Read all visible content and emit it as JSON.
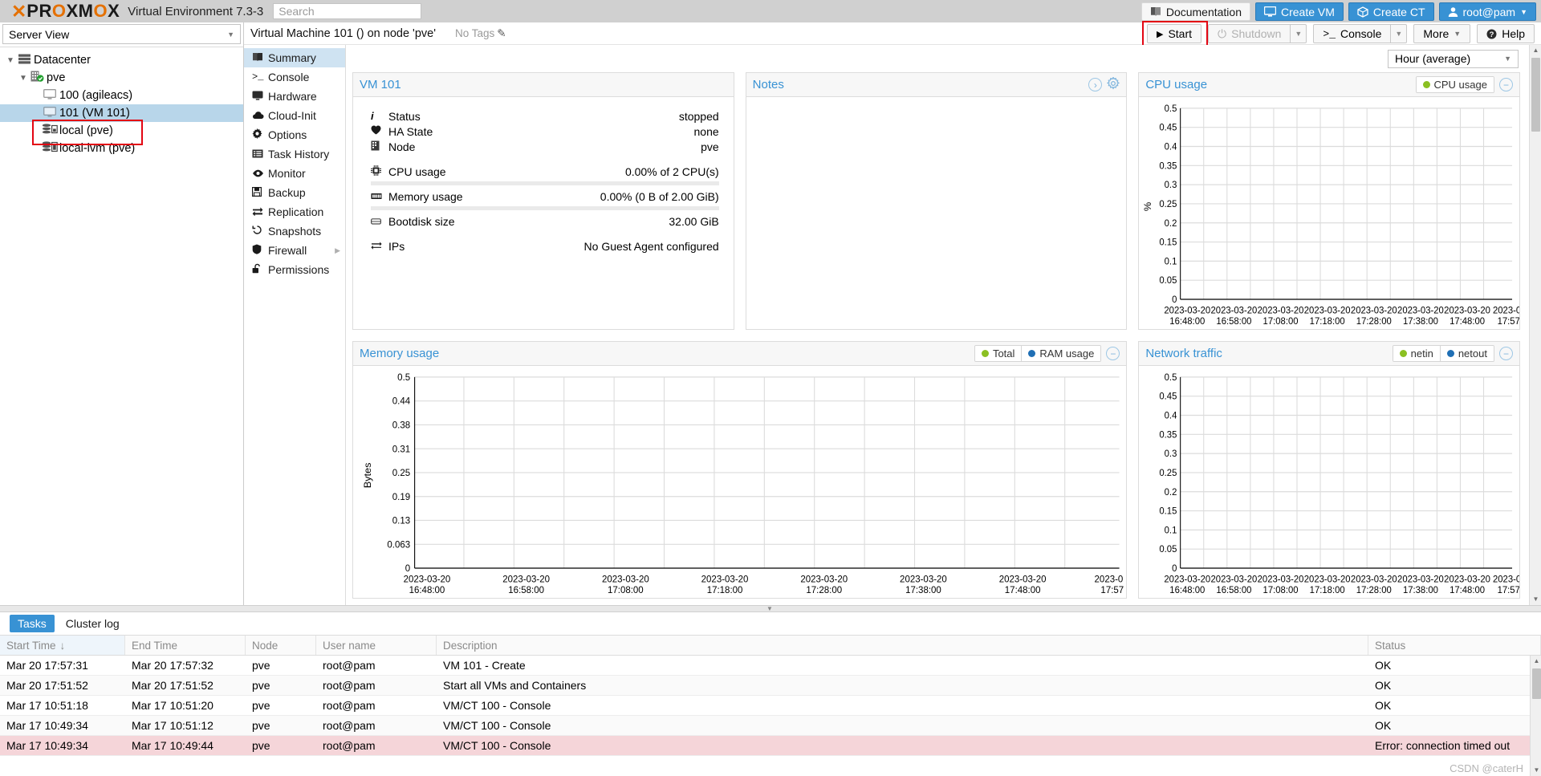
{
  "topbar": {
    "logo_text": "PROXMOX",
    "product": "Virtual Environment 7.3-3",
    "search_placeholder": "Search",
    "search_value": "",
    "documentation": "Documentation",
    "create_vm": "Create VM",
    "create_ct": "Create CT",
    "user": "root@pam"
  },
  "tree": {
    "view_label": "Server View",
    "nodes": [
      {
        "label": "Datacenter",
        "icon": "datacenter-icon",
        "depth": 0,
        "selected": false,
        "expanded": true
      },
      {
        "label": "pve",
        "icon": "node-icon",
        "depth": 1,
        "selected": false,
        "expanded": true
      },
      {
        "label": "100 (agileacs)",
        "icon": "vm-icon",
        "depth": 2,
        "selected": false,
        "expanded": false
      },
      {
        "label": "101 (VM 101)",
        "icon": "vm-icon",
        "depth": 2,
        "selected": true,
        "expanded": false
      },
      {
        "label": "local (pve)",
        "icon": "storage-icon",
        "depth": 2,
        "selected": false,
        "expanded": false
      },
      {
        "label": "local-lvm (pve)",
        "icon": "storage-icon",
        "depth": 2,
        "selected": false,
        "expanded": false
      }
    ]
  },
  "header": {
    "title": "Virtual Machine 101 () on node 'pve'",
    "tags_label": "No Tags",
    "actions": {
      "start": "Start",
      "shutdown": "Shutdown",
      "console": "Console",
      "more": "More",
      "help": "Help"
    }
  },
  "submenu": {
    "items": [
      {
        "label": "Summary",
        "icon": "summary-icon",
        "active": true,
        "arrow": false
      },
      {
        "label": "Console",
        "icon": "console-icon",
        "active": false,
        "arrow": false
      },
      {
        "label": "Hardware",
        "icon": "hardware-icon",
        "active": false,
        "arrow": false
      },
      {
        "label": "Cloud-Init",
        "icon": "cloud-icon",
        "active": false,
        "arrow": false
      },
      {
        "label": "Options",
        "icon": "gear-icon",
        "active": false,
        "arrow": false
      },
      {
        "label": "Task History",
        "icon": "task-history-icon",
        "active": false,
        "arrow": false
      },
      {
        "label": "Monitor",
        "icon": "eye-icon",
        "active": false,
        "arrow": false
      },
      {
        "label": "Backup",
        "icon": "save-icon",
        "active": false,
        "arrow": false
      },
      {
        "label": "Replication",
        "icon": "replication-icon",
        "active": false,
        "arrow": false
      },
      {
        "label": "Snapshots",
        "icon": "snapshot-icon",
        "active": false,
        "arrow": false
      },
      {
        "label": "Firewall",
        "icon": "shield-icon",
        "active": false,
        "arrow": true
      },
      {
        "label": "Permissions",
        "icon": "lock-open-icon",
        "active": false,
        "arrow": false
      }
    ]
  },
  "dashboard": {
    "range_value": "Hour (average)",
    "vm_panel": {
      "title": "VM 101",
      "rows": [
        {
          "icon": "info-icon",
          "key": "Status",
          "value": "stopped",
          "bar": false
        },
        {
          "icon": "heart-icon",
          "key": "HA State",
          "value": "none",
          "bar": false
        },
        {
          "icon": "node-icon",
          "key": "Node",
          "value": "pve",
          "bar": false
        },
        {
          "icon": "cpu-icon",
          "key": "CPU usage",
          "value": "0.00% of 2 CPU(s)",
          "bar": true
        },
        {
          "icon": "memory-icon",
          "key": "Memory usage",
          "value": "0.00% (0 B of 2.00 GiB)",
          "bar": true
        },
        {
          "icon": "disk-icon",
          "key": "Bootdisk size",
          "value": "32.00 GiB",
          "bar": false
        },
        {
          "icon": "network-icon",
          "key": "IPs",
          "value": "No Guest Agent configured",
          "bar": false
        }
      ]
    },
    "notes_panel": {
      "title": "Notes"
    }
  },
  "chart_data": [
    {
      "type": "line",
      "title": "CPU usage",
      "xlabel": "",
      "ylabel": "%",
      "ylim": [
        0,
        0.5
      ],
      "yticks": [
        "0",
        "0.05",
        "0.1",
        "0.15",
        "0.2",
        "0.25",
        "0.3",
        "0.35",
        "0.4",
        "0.45",
        "0.5"
      ],
      "xticks": [
        "2023-03-20\n16:48:00",
        "2023-03-20\n16:58:00",
        "2023-03-20\n17:08:00",
        "2023-03-20\n17:18:00",
        "2023-03-20\n17:28:00",
        "2023-03-20\n17:38:00",
        "2023-03-20\n17:48:00",
        "2023-0\n17:57"
      ],
      "grid": true,
      "legend": [
        {
          "name": "CPU usage",
          "color": "#8bc022"
        }
      ],
      "series": [
        {
          "name": "CPU usage",
          "values": []
        }
      ]
    },
    {
      "type": "line",
      "title": "Memory usage",
      "xlabel": "",
      "ylabel": "Bytes",
      "ylim": [
        0,
        0.5
      ],
      "yticks": [
        "0",
        "0.063",
        "0.13",
        "0.19",
        "0.25",
        "0.31",
        "0.38",
        "0.44",
        "0.5"
      ],
      "xticks": [
        "2023-03-20\n16:48:00",
        "2023-03-20\n16:58:00",
        "2023-03-20\n17:08:00",
        "2023-03-20\n17:18:00",
        "2023-03-20\n17:28:00",
        "2023-03-20\n17:38:00",
        "2023-03-20\n17:48:00",
        "2023-0\n17:57"
      ],
      "grid": true,
      "legend": [
        {
          "name": "Total",
          "color": "#8bc022"
        },
        {
          "name": "RAM usage",
          "color": "#1f6fb5"
        }
      ],
      "series": [
        {
          "name": "Total",
          "values": []
        },
        {
          "name": "RAM usage",
          "values": []
        }
      ]
    },
    {
      "type": "line",
      "title": "Network traffic",
      "xlabel": "",
      "ylabel": "",
      "ylim": [
        0,
        0.5
      ],
      "yticks": [
        "0",
        "0.05",
        "0.1",
        "0.15",
        "0.2",
        "0.25",
        "0.3",
        "0.35",
        "0.4",
        "0.45",
        "0.5"
      ],
      "xticks": [
        "2023-03-20\n16:48:00",
        "2023-03-20\n16:58:00",
        "2023-03-20\n17:08:00",
        "2023-03-20\n17:18:00",
        "2023-03-20\n17:28:00",
        "2023-03-20\n17:38:00",
        "2023-03-20\n17:48:00",
        "2023-0\n17:57"
      ],
      "grid": true,
      "legend": [
        {
          "name": "netin",
          "color": "#8bc022"
        },
        {
          "name": "netout",
          "color": "#1f6fb5"
        }
      ],
      "series": [
        {
          "name": "netin",
          "values": []
        },
        {
          "name": "netout",
          "values": []
        }
      ]
    }
  ],
  "bottom": {
    "tabs": [
      {
        "label": "Tasks",
        "active": true
      },
      {
        "label": "Cluster log",
        "active": false
      }
    ],
    "columns": [
      "Start Time",
      "End Time",
      "Node",
      "User name",
      "Description",
      "Status"
    ],
    "sort_indicator": "↓",
    "rows": [
      {
        "start": "Mar 20 17:57:31",
        "end": "Mar 20 17:57:32",
        "node": "pve",
        "user": "root@pam",
        "desc": "VM 101 - Create",
        "status": "OK",
        "error": false
      },
      {
        "start": "Mar 20 17:51:52",
        "end": "Mar 20 17:51:52",
        "node": "pve",
        "user": "root@pam",
        "desc": "Start all VMs and Containers",
        "status": "OK",
        "error": false
      },
      {
        "start": "Mar 17 10:51:18",
        "end": "Mar 17 10:51:20",
        "node": "pve",
        "user": "root@pam",
        "desc": "VM/CT 100 - Console",
        "status": "OK",
        "error": false
      },
      {
        "start": "Mar 17 10:49:34",
        "end": "Mar 17 10:51:12",
        "node": "pve",
        "user": "root@pam",
        "desc": "VM/CT 100 - Console",
        "status": "OK",
        "error": false
      },
      {
        "start": "Mar 17 10:49:34",
        "end": "Mar 17 10:49:44",
        "node": "pve",
        "user": "root@pam",
        "desc": "VM/CT 100 - Console",
        "status": "Error: connection timed out",
        "error": true
      }
    ],
    "watermark": "CSDN @caterH"
  },
  "colors": {
    "accent_blue": "#3892d4",
    "panel_title_blue": "#3892d4",
    "green": "#8bc022",
    "blue_series": "#1f6fb5",
    "annotation_red": "#e30613",
    "error_row": "#f5d5d9"
  }
}
